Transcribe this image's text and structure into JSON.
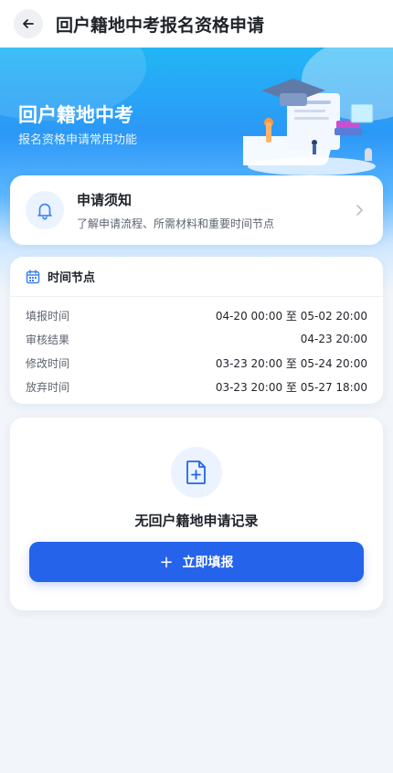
{
  "header": {
    "title": "回户籍地中考报名资格申请"
  },
  "hero": {
    "title": "回户籍地中考",
    "subtitle": "报名资格申请常用功能"
  },
  "notice": {
    "title": "申请须知",
    "description": "了解申请流程、所需材料和重要时间节点"
  },
  "timeline": {
    "title": "时间节点",
    "rows": [
      {
        "label": "填报时间",
        "value": "04-20 00:00 至 05-02 20:00"
      },
      {
        "label": "审核结果",
        "value": "04-23 20:00"
      },
      {
        "label": "修改时间",
        "value": "03-23 20:00 至 05-24 20:00"
      },
      {
        "label": "放弃时间",
        "value": "03-23 20:00 至 05-27 18:00"
      }
    ]
  },
  "empty": {
    "message": "无回户籍地申请记录",
    "button_label": "立即填报",
    "button_icon": "+"
  },
  "colors": {
    "primary": "#2563eb",
    "accent": "#3b82f6"
  }
}
